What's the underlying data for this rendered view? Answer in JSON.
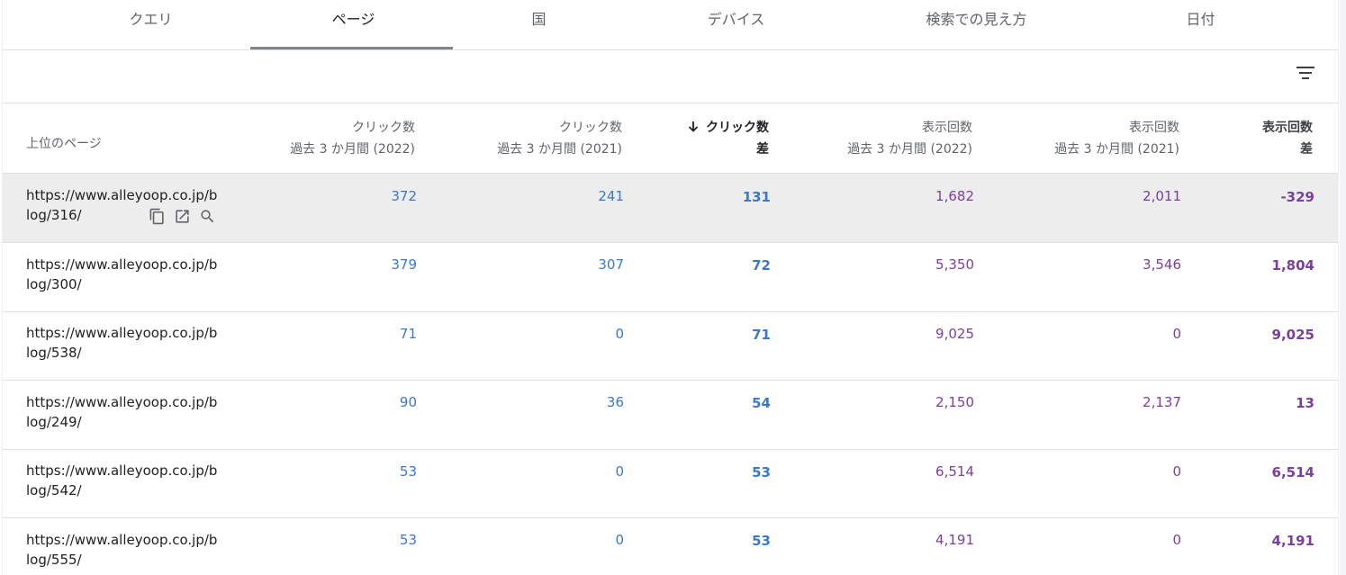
{
  "tabs": [
    {
      "label": "クエリ"
    },
    {
      "label": "ページ"
    },
    {
      "label": "国"
    },
    {
      "label": "デバイス"
    },
    {
      "label": "検索での見え方"
    },
    {
      "label": "日付"
    }
  ],
  "active_tab": "ページ",
  "header": {
    "page": "上位のページ",
    "clicks_2022_l1": "クリック数",
    "clicks_2022_l2": "過去 3 か月間 (2022)",
    "clicks_2021_l1": "クリック数",
    "clicks_2021_l2": "過去 3 か月間 (2021)",
    "clicks_diff_l1": "クリック数",
    "clicks_diff_l2": "差",
    "impr_2022_l1": "表示回数",
    "impr_2022_l2": "過去 3 か月間 (2022)",
    "impr_2021_l1": "表示回数",
    "impr_2021_l2": "過去 3 か月間 (2021)",
    "impr_diff_l1": "表示回数",
    "impr_diff_l2": "差",
    "sort_icon": "arrow-down-icon"
  },
  "rows": [
    {
      "url_l1": "https://www.alleyoop.co.jp/b",
      "url_l2": "log/316/",
      "c22": "372",
      "c21": "241",
      "cd": "131",
      "i22": "1,682",
      "i21": "2,011",
      "id": "-329"
    },
    {
      "url_l1": "https://www.alleyoop.co.jp/b",
      "url_l2": "log/300/",
      "c22": "379",
      "c21": "307",
      "cd": "72",
      "i22": "5,350",
      "i21": "3,546",
      "id": "1,804"
    },
    {
      "url_l1": "https://www.alleyoop.co.jp/b",
      "url_l2": "log/538/",
      "c22": "71",
      "c21": "0",
      "cd": "71",
      "i22": "9,025",
      "i21": "0",
      "id": "9,025"
    },
    {
      "url_l1": "https://www.alleyoop.co.jp/b",
      "url_l2": "log/249/",
      "c22": "90",
      "c21": "36",
      "cd": "54",
      "i22": "2,150",
      "i21": "2,137",
      "id": "13"
    },
    {
      "url_l1": "https://www.alleyoop.co.jp/b",
      "url_l2": "log/542/",
      "c22": "53",
      "c21": "0",
      "cd": "53",
      "i22": "6,514",
      "i21": "0",
      "id": "6,514"
    },
    {
      "url_l1": "https://www.alleyoop.co.jp/b",
      "url_l2": "log/555/",
      "c22": "53",
      "c21": "0",
      "cd": "53",
      "i22": "4,191",
      "i21": "0",
      "id": "4,191"
    }
  ],
  "row_icons": [
    "copy-icon",
    "open-in-new-icon",
    "search-icon"
  ],
  "colors": {
    "clicks": "#3a78c9",
    "impressions": "#7b3fa0"
  }
}
